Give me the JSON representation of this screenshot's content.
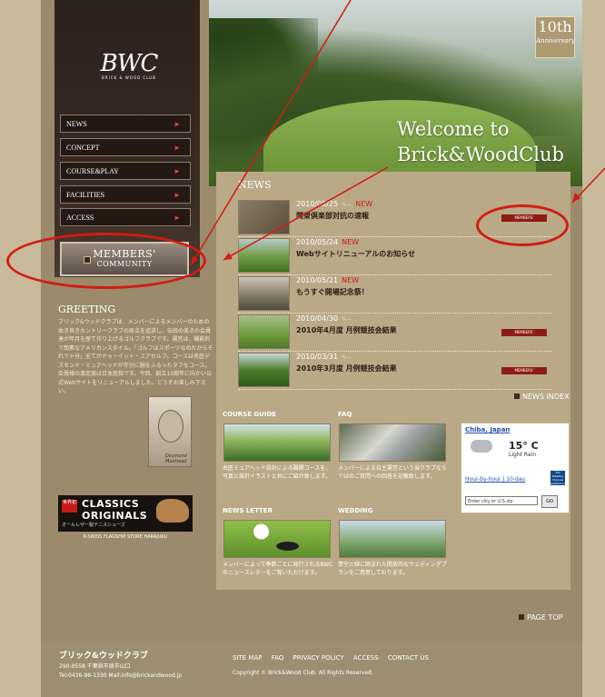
{
  "hero": {
    "welcome_line1": "Welcome to",
    "welcome_line2": "Brick&WoodClub",
    "anniversary_number": "10th",
    "anniversary_text": "Anniversary"
  },
  "logo": {
    "mark": "BWC",
    "subtitle": "BRICK & WOOD CLUB"
  },
  "nav": [
    {
      "label": "NEWS"
    },
    {
      "label": "CONCEPT"
    },
    {
      "label": "COURSE&PLAY"
    },
    {
      "label": "FACILITIES"
    },
    {
      "label": "ACCESS"
    }
  ],
  "members": {
    "line1": "MEMBERS'",
    "line2": "COMMUNITY"
  },
  "greeting": {
    "heading": "GREETING",
    "text": "ブリック&ウッドクラブは、メンバーによるメンバーのための由き良きカントリークラブの原点を追求し、伝統の美点の会員達が年月を歴て作り上げるゴルフクラブです。運営は、機能的で簡素なアメリカンスタイル。「ゴルフはスポーツなのだからそれで十分」全てがドゥ・イット・ユアセルフ。コースは名匠デズモンド・ミュアヘッドが存分に腕をふるったタフなコース。会員様の満足度は日本屈指です。今回、創立10周年に向かい公式Webサイトをリニューアルしました。どうぞお楽しみ下さい。",
    "signature": "Desmond Muirhead"
  },
  "kswiss": {
    "tag": "世界初",
    "line1": "CLASSICS",
    "line2": "ORIGINALS",
    "line3": "オールレザー製テニスシューズ",
    "caption": "K-SWISS FLAGSHIP STORE HARAJUKU"
  },
  "news": {
    "heading": "NEWS",
    "items": [
      {
        "date": "2010/05/25",
        "pen": "✎—",
        "new": "NEW",
        "title": "関東倶楽部対抗の速報",
        "members_badge": "MEMBERS'"
      },
      {
        "date": "2010/05/24",
        "pen": "",
        "new": "NEW",
        "title": "Webサイトリニューアルのお知らせ",
        "members_badge": ""
      },
      {
        "date": "2010/05/21",
        "pen": "",
        "new": "NEW",
        "title": "もうすぐ開場記念祭！",
        "members_badge": ""
      },
      {
        "date": "2010/04/30",
        "pen": "✎—",
        "new": "",
        "title": "2010年4月度 月例競技会結果",
        "members_badge": "MEMBERS'"
      },
      {
        "date": "2010/03/31",
        "pen": "✎—",
        "new": "",
        "title": "2010年3月度 月例競技会結果",
        "members_badge": "MEMBERS'"
      }
    ],
    "index_label": "NEWS INDEX"
  },
  "sections": {
    "course_guide": {
      "heading": "COURSE GUIDE",
      "text": "名匠ミュアヘッド設計による難関コースを、写真と設計イラストと共にご紹介致します。"
    },
    "faq": {
      "heading": "FAQ",
      "text": "メンバーによる自主運営という当クラブならではのご質問への回答を記載致します。"
    },
    "newsletter": {
      "heading": "NEWS LETTER",
      "text": "メンバーによって季節ごとに発行されるBWCのニュースレターをご覧いただけます。"
    },
    "wedding": {
      "heading": "WEDDING",
      "text": "青空と緑に囲まれた開放的なウェディングプランをご用意しております。"
    }
  },
  "weather": {
    "location": "Chiba, Japan",
    "temp": "15° C",
    "condition": "Light Rain",
    "links": "Hour-by-hour | 10-day",
    "brand": "The Weather Channel weather.com",
    "input_placeholder": "Enter city or U.S.zip",
    "go": "GO"
  },
  "page_top": "PAGE TOP",
  "footer": {
    "name": "ブリック&ウッドクラブ",
    "address": "290-0558 千葉県市原市山口",
    "contact": "Tel:0436-98-1330 Mail:info@brickandwood.jp",
    "links": [
      "SITE MAP",
      "FAQ",
      "PRIVACY POLICY",
      "ACCESS",
      "CONTACT US"
    ],
    "copyright": "Copyright © Brick&Wood Club. All Rights Reserved."
  },
  "colors": {
    "accent_red": "#c71f10",
    "annotation_red": "#d21c13",
    "members_badge": "#8e1c15"
  }
}
